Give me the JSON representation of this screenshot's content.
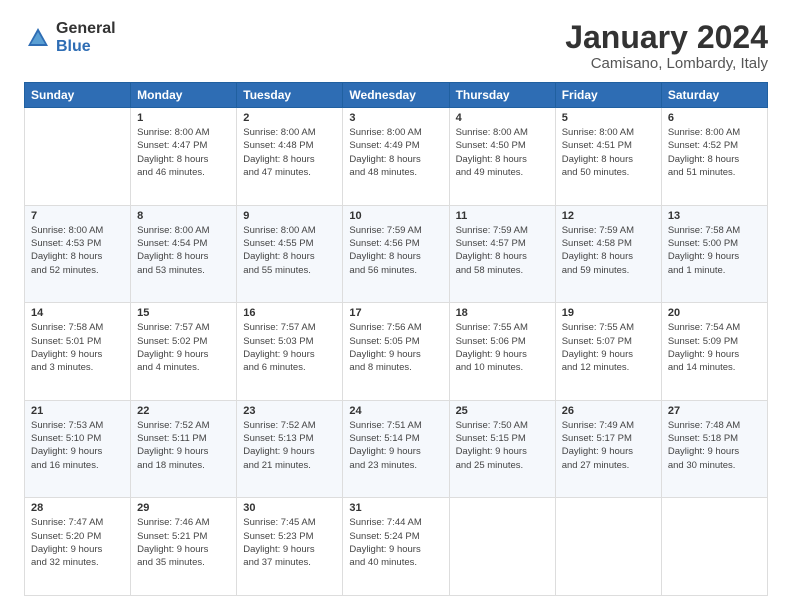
{
  "logo": {
    "general": "General",
    "blue": "Blue"
  },
  "header": {
    "title": "January 2024",
    "subtitle": "Camisano, Lombardy, Italy"
  },
  "weekdays": [
    "Sunday",
    "Monday",
    "Tuesday",
    "Wednesday",
    "Thursday",
    "Friday",
    "Saturday"
  ],
  "weeks": [
    [
      {
        "day": "",
        "info": ""
      },
      {
        "day": "1",
        "info": "Sunrise: 8:00 AM\nSunset: 4:47 PM\nDaylight: 8 hours\nand 46 minutes."
      },
      {
        "day": "2",
        "info": "Sunrise: 8:00 AM\nSunset: 4:48 PM\nDaylight: 8 hours\nand 47 minutes."
      },
      {
        "day": "3",
        "info": "Sunrise: 8:00 AM\nSunset: 4:49 PM\nDaylight: 8 hours\nand 48 minutes."
      },
      {
        "day": "4",
        "info": "Sunrise: 8:00 AM\nSunset: 4:50 PM\nDaylight: 8 hours\nand 49 minutes."
      },
      {
        "day": "5",
        "info": "Sunrise: 8:00 AM\nSunset: 4:51 PM\nDaylight: 8 hours\nand 50 minutes."
      },
      {
        "day": "6",
        "info": "Sunrise: 8:00 AM\nSunset: 4:52 PM\nDaylight: 8 hours\nand 51 minutes."
      }
    ],
    [
      {
        "day": "7",
        "info": "Sunrise: 8:00 AM\nSunset: 4:53 PM\nDaylight: 8 hours\nand 52 minutes."
      },
      {
        "day": "8",
        "info": "Sunrise: 8:00 AM\nSunset: 4:54 PM\nDaylight: 8 hours\nand 53 minutes."
      },
      {
        "day": "9",
        "info": "Sunrise: 8:00 AM\nSunset: 4:55 PM\nDaylight: 8 hours\nand 55 minutes."
      },
      {
        "day": "10",
        "info": "Sunrise: 7:59 AM\nSunset: 4:56 PM\nDaylight: 8 hours\nand 56 minutes."
      },
      {
        "day": "11",
        "info": "Sunrise: 7:59 AM\nSunset: 4:57 PM\nDaylight: 8 hours\nand 58 minutes."
      },
      {
        "day": "12",
        "info": "Sunrise: 7:59 AM\nSunset: 4:58 PM\nDaylight: 8 hours\nand 59 minutes."
      },
      {
        "day": "13",
        "info": "Sunrise: 7:58 AM\nSunset: 5:00 PM\nDaylight: 9 hours\nand 1 minute."
      }
    ],
    [
      {
        "day": "14",
        "info": "Sunrise: 7:58 AM\nSunset: 5:01 PM\nDaylight: 9 hours\nand 3 minutes."
      },
      {
        "day": "15",
        "info": "Sunrise: 7:57 AM\nSunset: 5:02 PM\nDaylight: 9 hours\nand 4 minutes."
      },
      {
        "day": "16",
        "info": "Sunrise: 7:57 AM\nSunset: 5:03 PM\nDaylight: 9 hours\nand 6 minutes."
      },
      {
        "day": "17",
        "info": "Sunrise: 7:56 AM\nSunset: 5:05 PM\nDaylight: 9 hours\nand 8 minutes."
      },
      {
        "day": "18",
        "info": "Sunrise: 7:55 AM\nSunset: 5:06 PM\nDaylight: 9 hours\nand 10 minutes."
      },
      {
        "day": "19",
        "info": "Sunrise: 7:55 AM\nSunset: 5:07 PM\nDaylight: 9 hours\nand 12 minutes."
      },
      {
        "day": "20",
        "info": "Sunrise: 7:54 AM\nSunset: 5:09 PM\nDaylight: 9 hours\nand 14 minutes."
      }
    ],
    [
      {
        "day": "21",
        "info": "Sunrise: 7:53 AM\nSunset: 5:10 PM\nDaylight: 9 hours\nand 16 minutes."
      },
      {
        "day": "22",
        "info": "Sunrise: 7:52 AM\nSunset: 5:11 PM\nDaylight: 9 hours\nand 18 minutes."
      },
      {
        "day": "23",
        "info": "Sunrise: 7:52 AM\nSunset: 5:13 PM\nDaylight: 9 hours\nand 21 minutes."
      },
      {
        "day": "24",
        "info": "Sunrise: 7:51 AM\nSunset: 5:14 PM\nDaylight: 9 hours\nand 23 minutes."
      },
      {
        "day": "25",
        "info": "Sunrise: 7:50 AM\nSunset: 5:15 PM\nDaylight: 9 hours\nand 25 minutes."
      },
      {
        "day": "26",
        "info": "Sunrise: 7:49 AM\nSunset: 5:17 PM\nDaylight: 9 hours\nand 27 minutes."
      },
      {
        "day": "27",
        "info": "Sunrise: 7:48 AM\nSunset: 5:18 PM\nDaylight: 9 hours\nand 30 minutes."
      }
    ],
    [
      {
        "day": "28",
        "info": "Sunrise: 7:47 AM\nSunset: 5:20 PM\nDaylight: 9 hours\nand 32 minutes."
      },
      {
        "day": "29",
        "info": "Sunrise: 7:46 AM\nSunset: 5:21 PM\nDaylight: 9 hours\nand 35 minutes."
      },
      {
        "day": "30",
        "info": "Sunrise: 7:45 AM\nSunset: 5:23 PM\nDaylight: 9 hours\nand 37 minutes."
      },
      {
        "day": "31",
        "info": "Sunrise: 7:44 AM\nSunset: 5:24 PM\nDaylight: 9 hours\nand 40 minutes."
      },
      {
        "day": "",
        "info": ""
      },
      {
        "day": "",
        "info": ""
      },
      {
        "day": "",
        "info": ""
      }
    ]
  ]
}
